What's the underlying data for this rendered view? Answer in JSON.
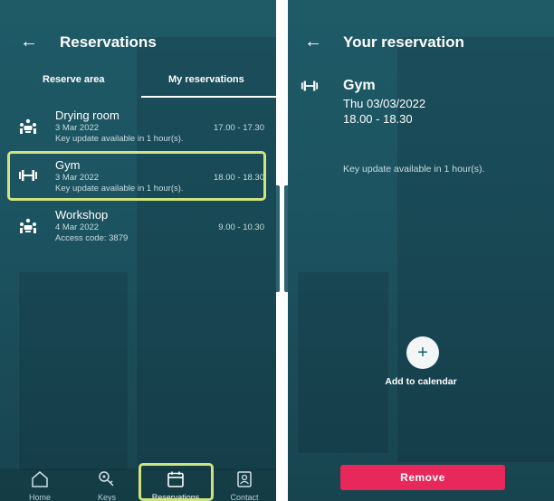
{
  "left": {
    "header": {
      "title": "Reservations"
    },
    "tabs": [
      {
        "label": "Reserve area",
        "active": false
      },
      {
        "label": "My reservations",
        "active": true
      }
    ],
    "reservations": [
      {
        "icon": "meeting-room-icon",
        "name": "Drying room",
        "date": "3 Mar 2022",
        "time": "17.00 - 17.30",
        "note": "Key update available in 1 hour(s)."
      },
      {
        "icon": "dumbbell-icon",
        "name": "Gym",
        "date": "3 Mar 2022",
        "time": "18.00 - 18.30",
        "note": "Key update available in 1 hour(s).",
        "highlighted": true
      },
      {
        "icon": "meeting-room-icon",
        "name": "Workshop",
        "date": "4 Mar 2022",
        "time": "9.00 - 10.30",
        "note": "Access code: 3879"
      }
    ],
    "nav": [
      {
        "label": "Home",
        "icon": "home-icon"
      },
      {
        "label": "Keys",
        "icon": "key-icon"
      },
      {
        "label": "Reservations",
        "icon": "calendar-icon",
        "active": true
      },
      {
        "label": "Contact",
        "icon": "contact-card-icon"
      }
    ]
  },
  "right": {
    "header": {
      "title": "Your reservation"
    },
    "detail": {
      "icon": "dumbbell-icon",
      "name": "Gym",
      "date": "Thu 03/03/2022",
      "time": "18.00 - 18.30",
      "note": "Key update available in 1 hour(s)."
    },
    "add_calendar": {
      "icon": "+",
      "label": "Add to calendar"
    },
    "remove_label": "Remove"
  },
  "colors": {
    "background": "#1f5a67",
    "highlight": "#cfe37e",
    "remove_button": "#e8275a"
  }
}
